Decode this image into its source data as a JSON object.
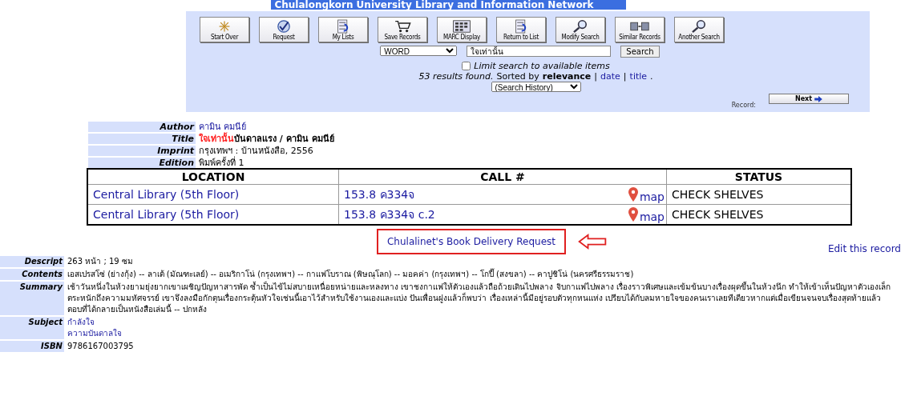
{
  "banner": {
    "title": "Chulalongkorn University Library and Information Network"
  },
  "toolbar": [
    {
      "label": "Start Over"
    },
    {
      "label": "Request"
    },
    {
      "label": "My Lists"
    },
    {
      "label": "Save Records"
    },
    {
      "label": "MARC Display"
    },
    {
      "label": "Return to List"
    },
    {
      "label": "Modify Search"
    },
    {
      "label": "Similar Records"
    },
    {
      "label": "Another Search"
    }
  ],
  "search": {
    "type": "WORD",
    "value": "ใจเท่านั้น",
    "button": "Search",
    "limit_label": "Limit search to available items",
    "limit_checked": false,
    "results": "53 results found.",
    "sorted_by": "Sorted by",
    "sort_options": [
      {
        "label": "relevance",
        "selected": true
      },
      {
        "label": "date",
        "selected": false
      },
      {
        "label": "title",
        "selected": false
      }
    ],
    "sort_separator": "|",
    "sort_end": ".",
    "history": "(Search History)"
  },
  "record_label": "Record:",
  "next_button": "Next",
  "details": [
    {
      "label": "Author",
      "value": "คามิน คมนีย์",
      "kind": "link"
    },
    {
      "label": "Title",
      "highlight": "ใจเท่านั้น",
      "value": "บันดาลแรง / คามิน คมนีย์",
      "kind": "title"
    },
    {
      "label": "Imprint",
      "value": "กรุงเทพฯ : บ้านหนังสือ, 2556",
      "kind": "text"
    },
    {
      "label": "Edition",
      "value": "พิมพ์ครั้งที่ 1",
      "kind": "text"
    }
  ],
  "holdings": {
    "columns": [
      "LOCATION",
      "CALL #",
      "STATUS"
    ],
    "rows": [
      {
        "location": "Central Library (5th Floor)",
        "call": "153.8 ค334จ",
        "map": "map",
        "status": "CHECK SHELVES"
      },
      {
        "location": "Central Library (5th Floor)",
        "call": "153.8 ค334จ c.2",
        "map": "map",
        "status": "CHECK SHELVES"
      }
    ]
  },
  "delivery_link": "Chulalinet's Book Delivery Request",
  "edit_link": "Edit this record",
  "more_details": [
    {
      "label": "Descript",
      "values": [
        "263 หน้า ; 19 ซม"
      ],
      "kind": "text"
    },
    {
      "label": "Contents",
      "values": [
        "เอสเปรสโซ่ (ย่างกุ้ง) -- ลาเต้ (มัณฑะเลย์) -- อเมริกาโน่ (กรุงเทพฯ) -- กาแฟโบราณ (พิษณุโลก) -- มอคค่า (กรุงเทพฯ) -- โกปี๊ (สงขลา) -- คาปูชิโน่ (นครศรีธรรมราช)"
      ],
      "kind": "text"
    },
    {
      "label": "Summary",
      "values": [
        "เช้าวันหนึ่งในห้วงยามยุ่งยากเขาเผชิญปัญหาสารพัด ซ้ำเป็นไข้ไม่สบายเหนื่อยหน่ายและหลงทาง เขาชงกาแฟให้ตัวเองแล้วถือถ้วยเดินไปพลาง จิบกาแฟไปพลาง เรื่องราวพิเศษและเข้มข้นบางเรื่องผุดขึ้นในห้วงนึก ทำให้เข้าเห็นปัญหาตัวเองเล็ก",
        "ตระหนักถึงความมหัศจรรย์ เขาจึงลงมือกักตุนเรื่องกระตุ้นหัวใจเช่นนี้เอาไว้สำหรับใช้งานเองและแบ่ง ปันเพื่อนฝูงแล้วก็พบว่า เรื่องเหล่านี้มีอยู่รอบตัวทุกหนแห่ง เปรียบได้กับลมหายใจของคนเราเลยทีเดียวหากแต่เมื่อเขียนจนจบเรื่องสุดท้ายแล้ว",
        "ตอบที่ได้กลายเป็นหนังสือเล่มนี้ -- ปกหลัง"
      ],
      "kind": "text"
    },
    {
      "label": "Subject",
      "values": [
        "กำลังใจ",
        "ความบันดาลใจ"
      ],
      "kind": "link"
    },
    {
      "label": "ISBN",
      "values": [
        "9786167003795"
      ],
      "kind": "text"
    }
  ]
}
